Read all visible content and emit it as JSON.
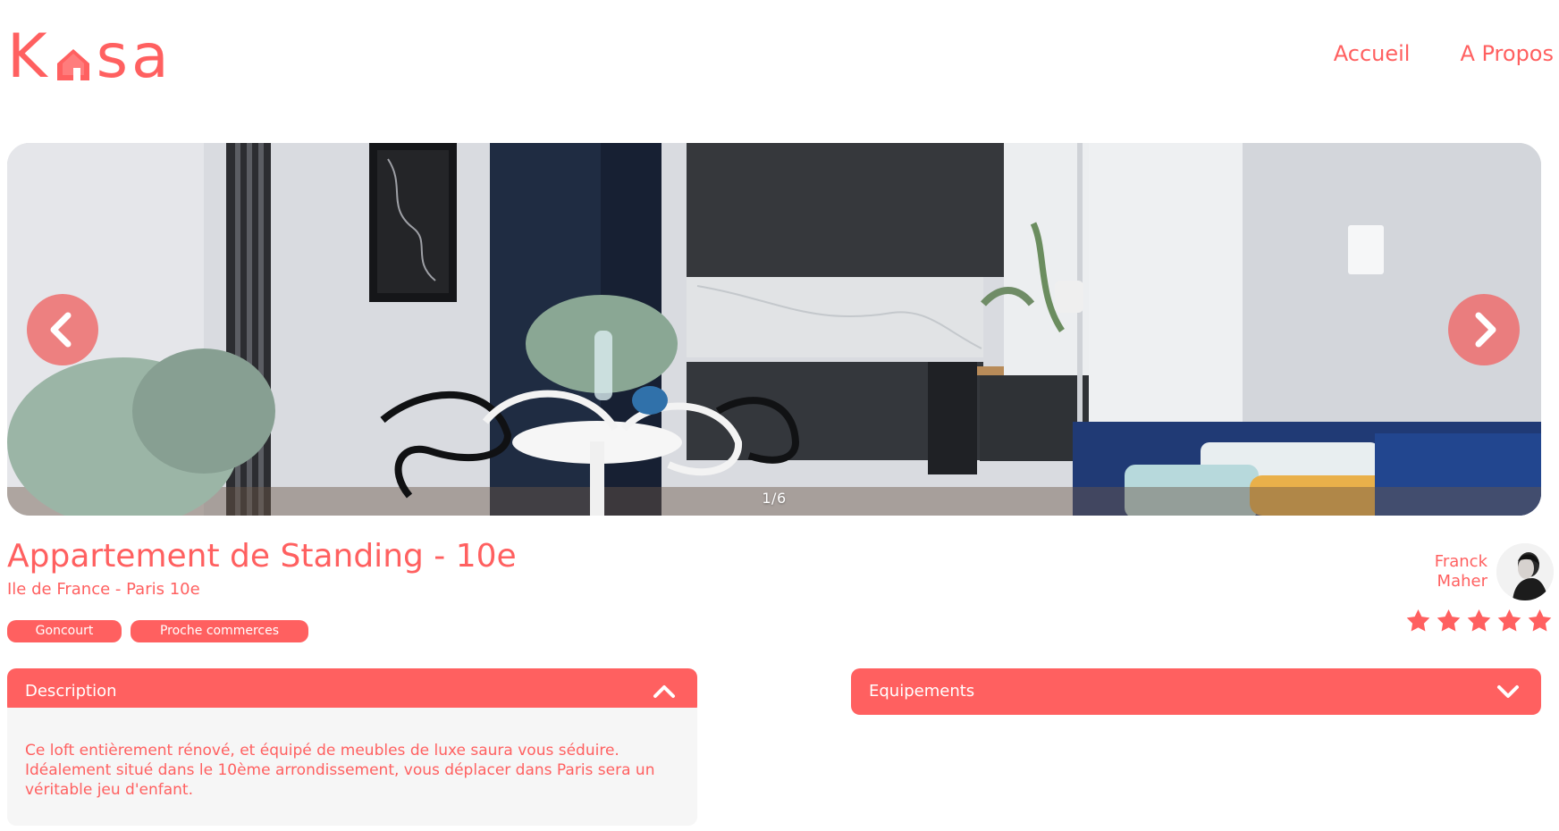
{
  "app": {
    "name": "Kasa",
    "accent_color": "#ff6060"
  },
  "header": {
    "logo": {
      "left": "K",
      "right": "sa",
      "icon": "house-icon"
    },
    "nav": [
      {
        "label": "Accueil"
      },
      {
        "label": "A Propos"
      }
    ]
  },
  "carousel": {
    "counter": "1/6",
    "left_icon": "chevron-left-icon",
    "right_icon": "chevron-right-icon"
  },
  "property": {
    "title": "Appartement de Standing - 10e",
    "location": "Ile de France - Paris 10e",
    "tags": [
      "Goncourt",
      "Proche commerces"
    ]
  },
  "host": {
    "first_name": "Franck",
    "last_name": "Maher"
  },
  "rating": {
    "value": 5,
    "max": 5,
    "icon": "star-icon"
  },
  "collapses": {
    "description": {
      "title": "Description",
      "expanded": true,
      "icon": "chevron-up-icon",
      "text": "Ce loft entièrement rénové, et équipé de meubles de luxe saura vous séduire. Idéalement situé dans le 10ème arrondissement, vous déplacer dans Paris sera un véritable jeu d'enfant."
    },
    "equipements": {
      "title": "Equipements",
      "expanded": false,
      "icon": "chevron-down-icon"
    }
  }
}
